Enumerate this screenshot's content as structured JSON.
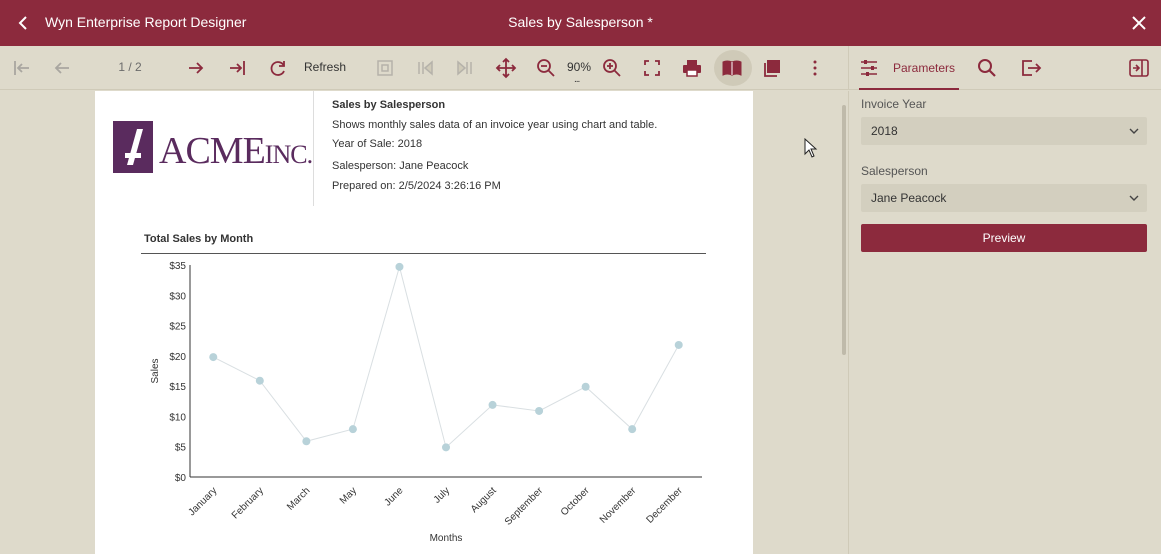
{
  "titlebar": {
    "app_title": "Wyn Enterprise Report Designer",
    "doc_title": "Sales by Salesperson *"
  },
  "toolbar": {
    "page_indicator": "1 / 2",
    "refresh_label": "Refresh",
    "zoom_level": "90%",
    "zoom_more": "..."
  },
  "panel": {
    "tab_label": "Parameters",
    "invoice_year_label": "Invoice Year",
    "invoice_year_value": "2018",
    "salesperson_label": "Salesperson",
    "salesperson_value": "Jane Peacock",
    "preview_label": "Preview"
  },
  "report": {
    "logo_text": "ACME",
    "logo_suffix": "INC.",
    "title": "Sales by Salesperson",
    "description": "Shows monthly sales data of an invoice year using chart and table.",
    "year_of_sale": "Year of Sale: 2018",
    "salesperson": "Salesperson: Jane Peacock",
    "prepared_on": "Prepared on: 2/5/2024 3:26:16 PM",
    "chart_title": "Total Sales by Month"
  },
  "chart_data": {
    "type": "line",
    "title": "Total Sales by Month",
    "xlabel": "Months",
    "ylabel": "Sales",
    "categories": [
      "January",
      "February",
      "March",
      "May",
      "June",
      "July",
      "August",
      "September",
      "October",
      "November",
      "December"
    ],
    "series": [
      {
        "values": [
          19.8,
          15.9,
          5.9,
          7.9,
          34.7,
          4.9,
          11.9,
          10.9,
          14.9,
          7.9,
          21.8
        ]
      }
    ],
    "ylim": [
      0,
      35
    ],
    "yticks": [
      "$0",
      "$5",
      "$10",
      "$15",
      "$20",
      "$25",
      "$30",
      "$35"
    ],
    "grid": false,
    "colors": {
      "line": "#d9dfe2",
      "marker": "#b8d2d9"
    }
  }
}
